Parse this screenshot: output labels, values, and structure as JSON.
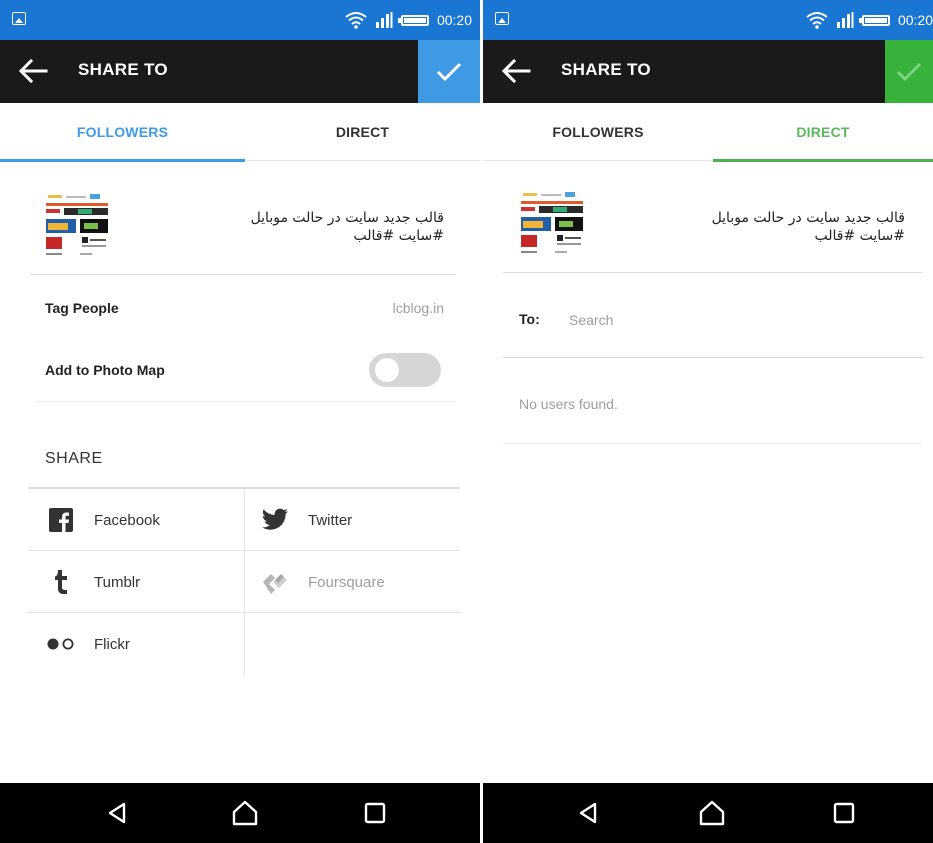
{
  "status_bar": {
    "time": "00:20"
  },
  "action_bar": {
    "title": "SHARE TO"
  },
  "colors": {
    "followers_accent": "#3f9ae6",
    "direct_accent": "#4caf50",
    "status_bar": "#1976d2",
    "action_bar": "#1a1a1a"
  },
  "tabs": {
    "followers": "FOLLOWERS",
    "direct": "DIRECT"
  },
  "post": {
    "caption_line1": "قالب جدید سایت در حالت موبایل",
    "caption_line2": "#سایت #قالب"
  },
  "followers": {
    "tag_people_label": "Tag People",
    "tag_people_value": "lcblog.in",
    "photo_map_label": "Add to Photo Map",
    "photo_map_enabled": false,
    "share_heading": "SHARE",
    "share_options": [
      {
        "label": "Facebook",
        "icon": "facebook-icon",
        "enabled": true
      },
      {
        "label": "Twitter",
        "icon": "twitter-icon",
        "enabled": true
      },
      {
        "label": "Tumblr",
        "icon": "tumblr-icon",
        "enabled": true
      },
      {
        "label": "Foursquare",
        "icon": "foursquare-icon",
        "enabled": false
      },
      {
        "label": "Flickr",
        "icon": "flickr-icon",
        "enabled": true
      }
    ]
  },
  "direct": {
    "to_label": "To:",
    "search_placeholder": "Search",
    "search_value": "",
    "empty_message": "No users found."
  }
}
